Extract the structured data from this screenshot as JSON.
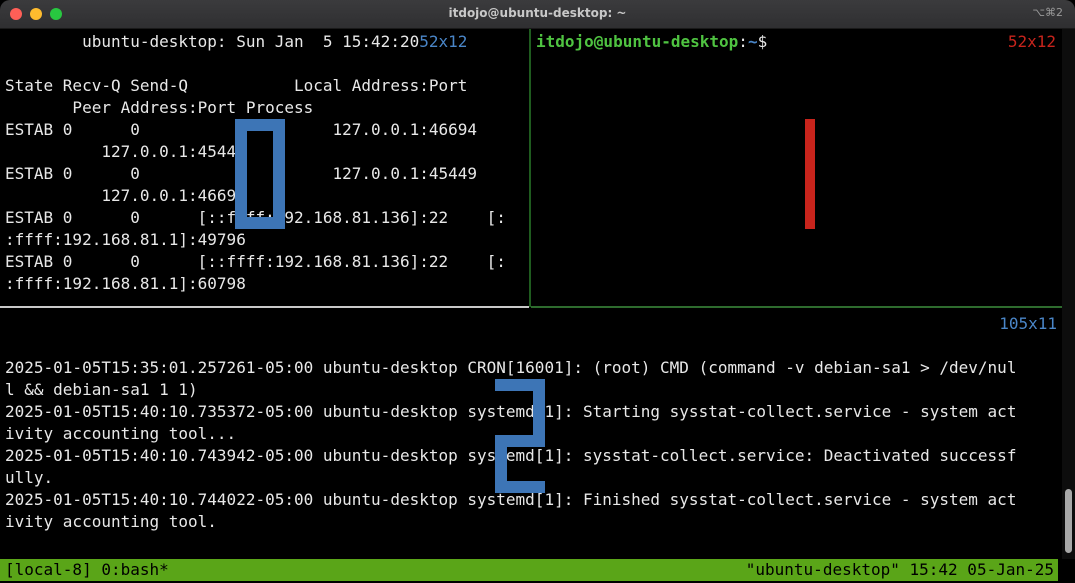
{
  "window": {
    "title": "itdojo@ubuntu-desktop: ~",
    "shortcut": "⌥⌘2"
  },
  "left_pane": {
    "clock_line": "        ubuntu-desktop: Sun Jan  5 15:42:20",
    "size": "52x12",
    "lines": [
      "",
      "State Recv-Q Send-Q           Local Address:Port",
      "       Peer Address:Port Process",
      "ESTAB 0      0                    127.0.0.1:46694",
      "          127.0.0.1:45449",
      "ESTAB 0      0                    127.0.0.1:45449",
      "          127.0.0.1:46694",
      "ESTAB 0      0      [::ffff:192.168.81.136]:22    [:",
      ":ffff:192.168.81.1]:49796",
      "ESTAB 0      0      [::ffff:192.168.81.136]:22    [:",
      ":ffff:192.168.81.1]:60798"
    ]
  },
  "right_pane": {
    "prompt_user": "itdojo@ubuntu-desktop",
    "prompt_sep": ":",
    "prompt_path": "~",
    "prompt_end": "$",
    "size": "52x12"
  },
  "bottom_pane": {
    "size": "105x11",
    "lines": [
      "",
      "2025-01-05T15:35:01.257261-05:00 ubuntu-desktop CRON[16001]: (root) CMD (command -v debian-sa1 > /dev/nul",
      "l && debian-sa1 1 1)",
      "2025-01-05T15:40:10.735372-05:00 ubuntu-desktop systemd[1]: Starting sysstat-collect.service - system act",
      "ivity accounting tool...",
      "2025-01-05T15:40:10.743942-05:00 ubuntu-desktop systemd[1]: sysstat-collect.service: Deactivated successf",
      "ully.",
      "2025-01-05T15:40:10.744022-05:00 ubuntu-desktop systemd[1]: Finished sysstat-collect.service - system act",
      "ivity accounting tool."
    ]
  },
  "status_bar": {
    "left": "[local-8] 0:bash*",
    "right": "\"ubuntu-desktop\" 15:42 05-Jan-25"
  },
  "colors": {
    "status_bar": "#5aa518",
    "pane_border_active": "#2e6b2e",
    "prompt_user": "#4fc341",
    "size_indicator": "#4a86c8",
    "size_indicator_active": "#c8241c"
  }
}
